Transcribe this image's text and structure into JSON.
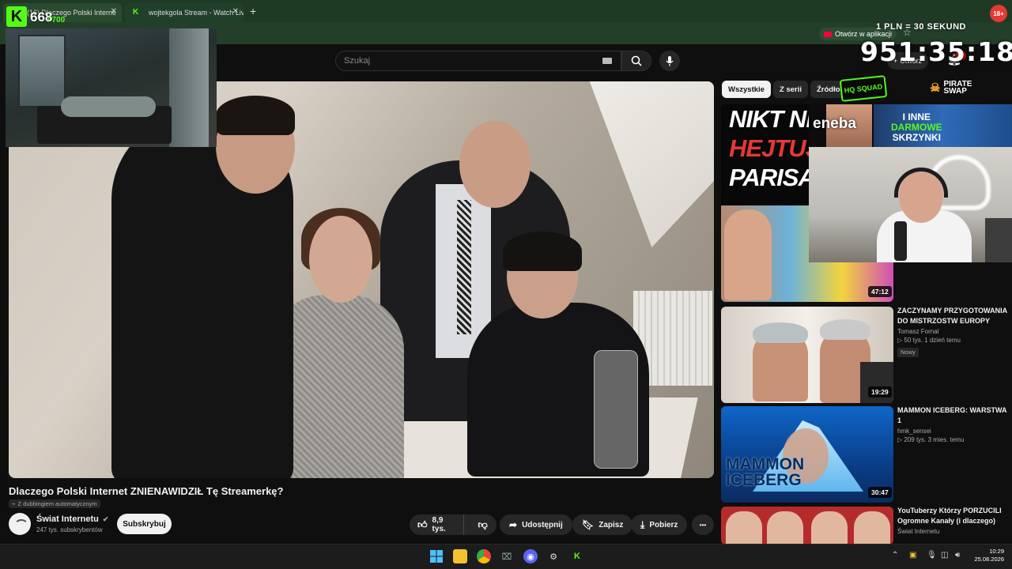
{
  "browser": {
    "tabs": [
      {
        "label": "(16) Dlaczego Polski Interne"
      },
      {
        "label": "wojtekgola Stream - Watch Live"
      }
    ],
    "new_tab": "+",
    "open_in_app": "Otwórz w aplikacji",
    "age_badge": "18+"
  },
  "overlay": {
    "kick_logo": "K",
    "viewers": "668",
    "viewers_sub": "/ 700",
    "pln_text": "1 PLN = 30 SEKUND",
    "timer": "951:35:18",
    "hq_badge": "HQ SQUAD",
    "sponsor_eneba": "eneba",
    "sponsor_inne_line1": "I INNE",
    "sponsor_inne_line2": "DARMOWE",
    "sponsor_inne_line3": "SKRZYNKI",
    "pirate_line1": "PIRATE",
    "pirate_line2": "SWAP"
  },
  "youtube": {
    "search_placeholder": "Szukaj",
    "create_label": "Utwórz",
    "notification_count": "9+",
    "video": {
      "title": "Dlaczego Polski Internet ZNIENAWIDZIŁ Tę Streamerkę?",
      "dub_note": "Z dubbingiem automatycznym",
      "channel_name": "Świat Internetu",
      "subscribers": "247 tys. subskrybentów",
      "subscribe_label": "Subskrybuj",
      "likes": "8,9 tys.",
      "share_label": "Udostępnij",
      "save_label": "Zapisz",
      "download_label": "Pobierz",
      "more_label": "•••"
    },
    "chips": [
      "Wszystkie",
      "Z serii",
      "Źródło: Ś"
    ],
    "recommendations": [
      {
        "thumb_line1": "NIKT NIE",
        "thumb_line2": "HEJTUJE",
        "thumb_line3": "PARISA",
        "duration": "47:12"
      },
      {
        "title": "ZACZYNAMY PRZYGOTOWANIA DO MISTRZOSTW EUROPY",
        "channel": "Tomasz Fornal",
        "meta": "▷ 50 tys.   1 dzień temu",
        "badge": "Nowy",
        "duration": "19:29"
      },
      {
        "title": "MAMMON ICEBERG: WARSTWA 1",
        "channel": "hmk_sensei",
        "meta": "▷ 209 tys.   3 mies. temu",
        "thumb_text_line1": "MAMMON",
        "thumb_text_line2": "ICEBERG",
        "duration": "30:47"
      },
      {
        "title": "YouTuberzy Którzy PORZUCILI Ogromne Kanały (i dlaczego)",
        "channel": "Świat Internetu"
      }
    ]
  },
  "taskbar": {
    "time": "10:29",
    "date": "25.08.2026"
  },
  "colors": {
    "kick_green": "#53fc18",
    "yt_bg": "#0f0f0f",
    "browser_bar": "#1f3a24"
  }
}
